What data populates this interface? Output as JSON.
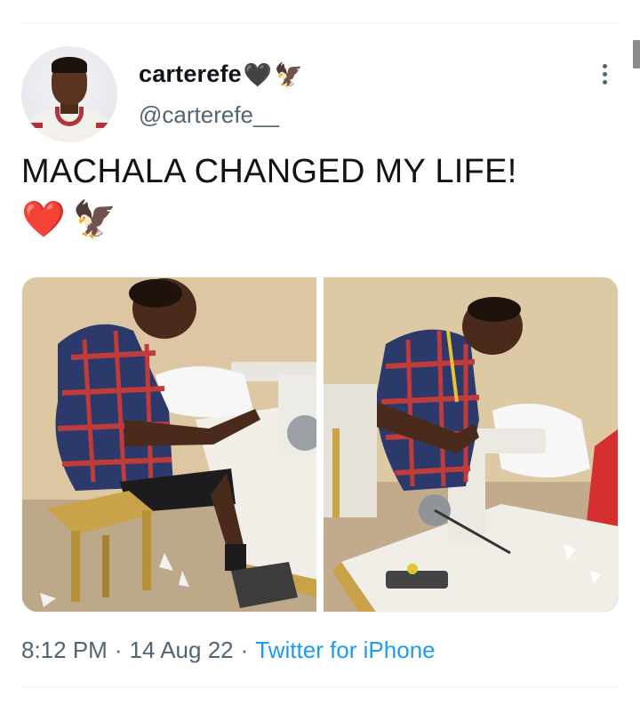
{
  "user": {
    "display_name": "carterefe",
    "name_emojis": [
      "🖤",
      "🦅"
    ],
    "handle": "@carterefe__"
  },
  "tweet": {
    "text": "MACHALA CHANGED MY LIFE!",
    "emojis": [
      "❤️",
      "🦅"
    ],
    "time": "8:12 PM",
    "separator": "·",
    "date": "14 Aug 22",
    "source": "Twitter for iPhone"
  },
  "icons": {
    "more": "more-horizontal-icon",
    "avatar": "avatar"
  },
  "colors": {
    "text_primary": "#0f1419",
    "text_secondary": "#536471",
    "link": "#1d9bf0",
    "divider": "#eff3f4"
  }
}
